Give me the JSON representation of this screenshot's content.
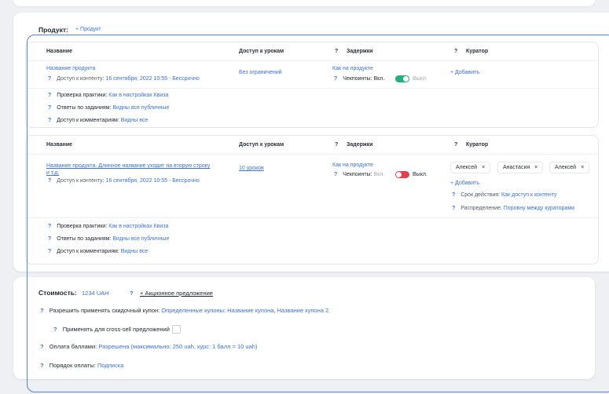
{
  "product": {
    "title": "Продукт:",
    "add_link": "+ Продукт",
    "columns": {
      "name": "Название",
      "access": "Доступ к урокам",
      "delays": "Задержки",
      "curator": "Куратор"
    },
    "q": "?",
    "card1": {
      "name": "Название продукта",
      "content_access_label": "Доступ к контенту:",
      "content_access_value": "16 сентября, 2022 10:55 - Бессрочно",
      "lesson_access": "Без ограничений",
      "delays_link": "Как на продукте",
      "checkpoints_label": "Чекпоинты:",
      "on_label": "Вкл.",
      "off_label": "Выкл.",
      "checkpoints_enabled": true,
      "add_curator": "+ Добавить",
      "practice_label": "Проверка практики:",
      "practice_value": "Как в настройках Квиза",
      "answers_label": "Ответы по заданиям:",
      "answers_value": "Видны все публичные",
      "comments_label": "Доступ к комментариям:",
      "comments_value": "Видны все"
    },
    "card2": {
      "name_line1": "Название продукта. Длинное название уходит на вторую строку",
      "name_line2": "и т.д.",
      "content_access_label": "Доступ к контенту:",
      "content_access_value": "16 сентября, 2022 10:55 - Бессрочно",
      "lesson_access": "10 уроков",
      "delays_link": "Как на продукте",
      "checkpoints_label": "Чекпоинты:",
      "on_label": "Вкл.",
      "off_label": "Выкл.",
      "checkpoints_enabled": false,
      "curators": [
        "Алексей",
        "Анастасия",
        "Алексей"
      ],
      "chip_close": "×",
      "add_curator": "+ Добавить",
      "validity_label": "Срок действия:",
      "validity_value": "Как доступ к контенту",
      "distribution_label": "Распределение:",
      "distribution_value": "Поровну между кураторами",
      "practice_label": "Проверка практики:",
      "practice_value": "Как в настройках Квиза",
      "answers_label": "Ответы по заданиям:",
      "answers_value": "Видны все публичные",
      "comments_label": "Доступ к комментариям:",
      "comments_value": "Видны все"
    }
  },
  "cost": {
    "title": "Стоимость:",
    "value": "1234 UAH",
    "promo": "+ Акционное предложение",
    "coupon_label": "Разрешить применять скидочный купон:",
    "coupon_value": "Определенные купоны: Название купона, Название купона 2",
    "cross_sell_label": "Применять для cross-sell предложений",
    "points_label": "Оплата баллами:",
    "points_value": "Разрешена (максимально: 250 uah, курс: 1 балл = 10 uah)",
    "order_label": "Порядок оплаты:",
    "order_value": "Подписка"
  },
  "colors": {
    "accent": "#3b71d8",
    "toggle_on": "#22b07d",
    "toggle_off": "#e2414b",
    "outline": "#4e86e0"
  }
}
